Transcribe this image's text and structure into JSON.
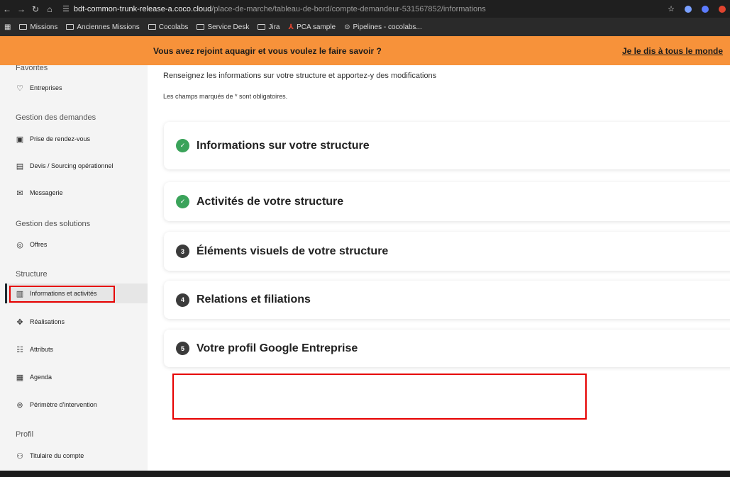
{
  "browser": {
    "url_host": "bdt-common-trunk-release-a.coco.cloud",
    "url_path": "/place-de-marche/tableau-de-bord/compte-demandeur-531567852/informations",
    "bookmarks": [
      "Missions",
      "Anciennes Missions",
      "Cocolabs",
      "Service Desk",
      "Jira",
      "PCA sample",
      "Pipelines - cocolabs..."
    ]
  },
  "banner": {
    "text": "Vous avez rejoint aquagir et vous voulez le faire savoir ?",
    "link": "Je le dis à tous le monde",
    "color": "#f7923a"
  },
  "sidebar": {
    "favorites_title": "Favorites",
    "favorites_item": "Entreprises",
    "demandes_title": "Gestion des demandes",
    "demandes_items": [
      "Prise de rendez-vous",
      "Devis / Sourcing opérationnel",
      "Messagerie"
    ],
    "solutions_title": "Gestion des solutions",
    "solutions_items": [
      "Offres"
    ],
    "structure_title": "Structure",
    "structure_items": [
      "Informations et activités",
      "Réalisations",
      "Attributs",
      "Agenda",
      "Périmètre d'intervention"
    ],
    "profil_title": "Profil",
    "profil_items": [
      "Titulaire du compte"
    ]
  },
  "main": {
    "intro": "Renseignez les informations sur votre structure et apportez-y des modifications",
    "note": "Les champs marqués de * sont obligatoires.",
    "sections": [
      {
        "badge": "✓",
        "title": "Informations sur votre structure"
      },
      {
        "badge": "✓",
        "title": "Activités de votre structure"
      },
      {
        "badge": "3",
        "title": "Éléments visuels de votre structure"
      },
      {
        "badge": "4",
        "title": "Relations et filiations"
      },
      {
        "badge": "5",
        "title": "Votre profil Google Entreprise"
      }
    ]
  }
}
